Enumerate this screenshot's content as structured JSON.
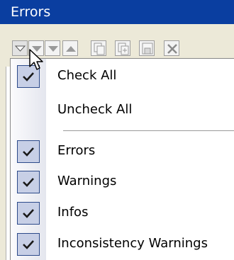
{
  "window": {
    "title": "Errors"
  },
  "toolbar": {
    "buttons": [
      {
        "icon": "filter-dropdown-icon"
      },
      {
        "icon": "arrow-down-icon"
      },
      {
        "icon": "arrow-up-icon"
      },
      {
        "icon": "copy-icon"
      },
      {
        "icon": "copy-all-icon"
      },
      {
        "icon": "save-icon"
      },
      {
        "icon": "delete-icon"
      }
    ]
  },
  "menu": {
    "check_all": {
      "label": "Check All",
      "checked": true
    },
    "uncheck_all": {
      "label": "Uncheck All"
    },
    "items": [
      {
        "label": "Errors",
        "checked": true
      },
      {
        "label": "Warnings",
        "checked": true
      },
      {
        "label": "Infos",
        "checked": true
      },
      {
        "label": "Inconsistency Warnings",
        "checked": true
      }
    ]
  },
  "colors": {
    "titlebar": "#0a3ea0",
    "toolbar": "#ece9d8",
    "check_fill": "#c7cfe6",
    "check_border": "#2c4a8a"
  }
}
